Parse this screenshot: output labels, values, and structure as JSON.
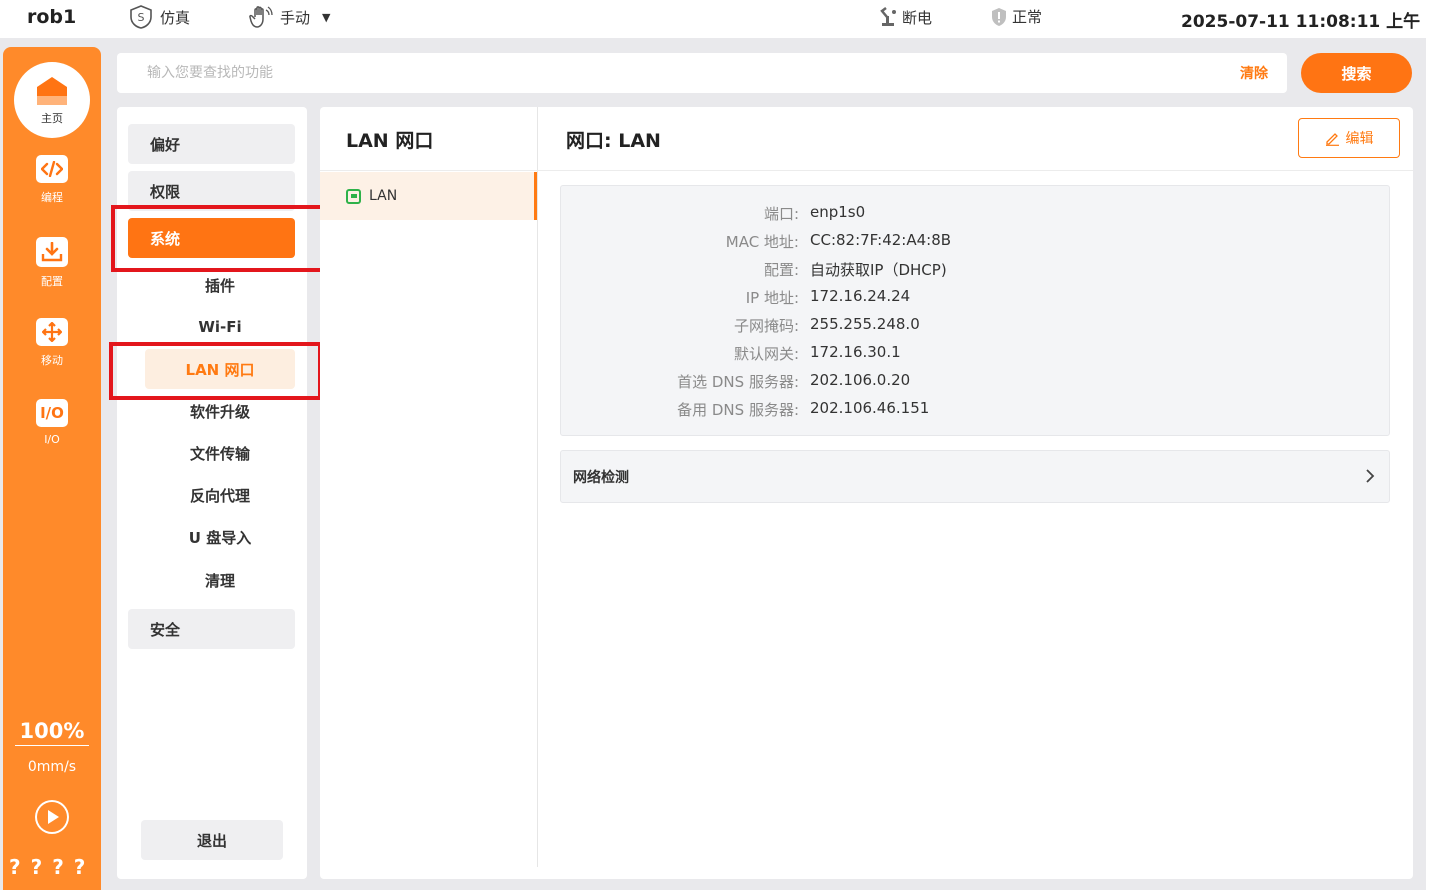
{
  "topbar": {
    "robot_name": "rob1",
    "sim_label": "仿真",
    "manual_label": "手动",
    "power_label": "断电",
    "status_label": "正常",
    "datetime": "2025-07-11 11:08:11 上午"
  },
  "rail": {
    "home_label": "主页",
    "items": [
      {
        "label": "编程",
        "icon": "code-icon"
      },
      {
        "label": "配置",
        "icon": "download-icon"
      },
      {
        "label": "移动",
        "icon": "move-arrows-icon"
      },
      {
        "label": "I/O",
        "icon": "io-icon"
      }
    ],
    "speed_percent": "100%",
    "speed_mms": "0mm/s",
    "unknown_text": "????"
  },
  "search": {
    "placeholder": "输入您要查找的功能",
    "clear_label": "清除",
    "search_label": "搜索"
  },
  "nav": {
    "groups": {
      "preferences": "偏好",
      "permissions": "权限",
      "system": "系统",
      "security": "安全"
    },
    "system_items": [
      "插件",
      "Wi-Fi",
      "LAN 网口",
      "软件升级",
      "文件传输",
      "反向代理",
      "U 盘导入",
      "清理"
    ],
    "logout_label": "退出"
  },
  "content": {
    "list_title": "LAN 网口",
    "list_items": [
      "LAN"
    ],
    "detail_title": "网口:  LAN",
    "edit_label": "编辑",
    "info": [
      {
        "key": "端口:",
        "value": "enp1s0"
      },
      {
        "key": "MAC 地址:",
        "value": "CC:82:7F:42:A4:8B"
      },
      {
        "key": "配置:",
        "value": "自动获取IP（DHCP)"
      },
      {
        "key": "IP 地址:",
        "value": "172.16.24.24"
      },
      {
        "key": "子网掩码:",
        "value": "255.255.248.0"
      },
      {
        "key": "默认网关:",
        "value": "172.16.30.1"
      },
      {
        "key": "首选 DNS 服务器:",
        "value": "202.106.0.20"
      },
      {
        "key": "备用 DNS 服务器:",
        "value": "202.106.46.151"
      }
    ],
    "netcheck_label": "网络检测"
  },
  "colors": {
    "accent": "#ff7413",
    "rail": "#ff8a2a",
    "highlight_box": "#e3161c",
    "lan_green": "#2eb24a"
  }
}
